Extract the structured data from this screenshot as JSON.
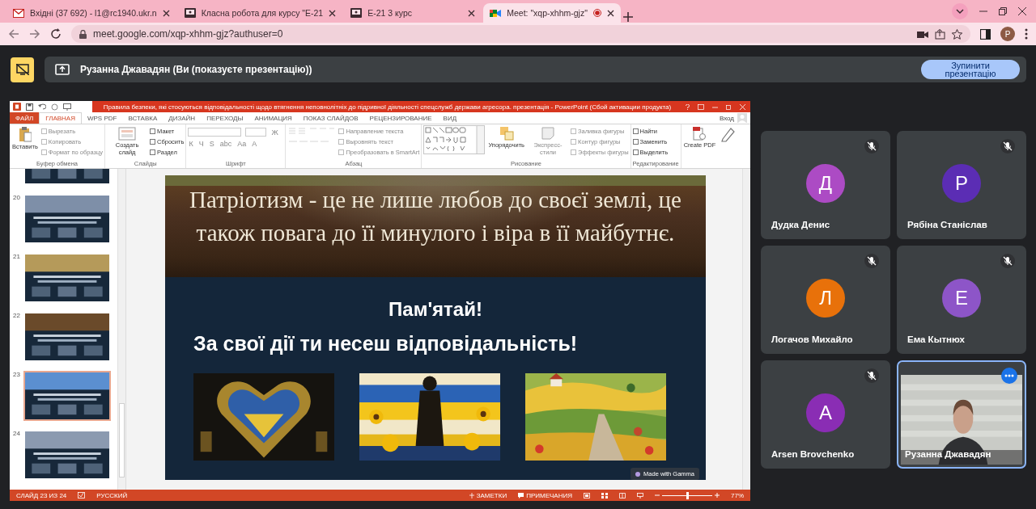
{
  "browser": {
    "tabs": [
      {
        "title": "Вхідні (37 692) - l1@rc1940.ukr.n",
        "kind": "mail",
        "selected": false,
        "recording": false
      },
      {
        "title": "Класна робота для курсу \"Е-21",
        "kind": "classroom",
        "selected": false,
        "recording": false
      },
      {
        "title": "Е-21 3 курс",
        "kind": "classroom",
        "selected": false,
        "recording": false
      },
      {
        "title": "Meet: \"xqp-xhhm-gjz\"",
        "kind": "meet",
        "selected": true,
        "recording": true
      }
    ],
    "url": "meet.google.com/xqp-xhhm-gjz?authuser=0",
    "profile": "P"
  },
  "meet": {
    "presenter_banner": "Рузанна Джавадян (Ви (показуєте презентацію))",
    "stop_button": "Зупинити презентацію"
  },
  "powerpoint": {
    "title": "Правила безпеки, які стосуються відповідальності щодо втягнення неповнолітніх до підривної діяльності спецслужб держави агресора. презентація - PowerPoint (Сбой активации продукта)",
    "ribbon_tabs": [
      {
        "label": "ФАЙЛ",
        "kind": "file",
        "selected": false
      },
      {
        "label": "ГЛАВНАЯ",
        "kind": "tab",
        "selected": true
      },
      {
        "label": "WPS PDF",
        "kind": "tab",
        "selected": false
      },
      {
        "label": "ВСТАВКА",
        "kind": "tab",
        "selected": false
      },
      {
        "label": "ДИЗАЙН",
        "kind": "tab",
        "selected": false
      },
      {
        "label": "ПЕРЕХОДЫ",
        "kind": "tab",
        "selected": false
      },
      {
        "label": "АНИМАЦИЯ",
        "kind": "tab",
        "selected": false
      },
      {
        "label": "ПОКАЗ СЛАЙДОВ",
        "kind": "tab",
        "selected": false
      },
      {
        "label": "РЕЦЕНЗИРОВАНИЕ",
        "kind": "tab",
        "selected": false
      },
      {
        "label": "ВИД",
        "kind": "tab",
        "selected": false
      }
    ],
    "sign_in": "Вход",
    "groups": [
      {
        "label": "Буфер обмена",
        "items": [
          {
            "kind": "large",
            "label": "Вставить",
            "disabled": false
          },
          {
            "kind": "small",
            "label": "Вырезать",
            "disabled": true
          },
          {
            "kind": "small",
            "label": "Копировать",
            "disabled": true
          },
          {
            "kind": "small",
            "label": "Формат по образцу",
            "disabled": true
          }
        ]
      },
      {
        "label": "Слайды",
        "items": [
          {
            "kind": "large",
            "label": "Создать слайд",
            "disabled": false
          },
          {
            "kind": "small",
            "label": "Макет",
            "disabled": false
          },
          {
            "kind": "small",
            "label": "Сбросить",
            "disabled": false
          },
          {
            "kind": "small",
            "label": "Раздел",
            "disabled": false
          }
        ]
      },
      {
        "label": "Шрифт",
        "items": [
          {
            "kind": "field"
          },
          {
            "kind": "field"
          },
          {
            "kind": "format",
            "label": "Ж",
            "disabled": true
          },
          {
            "kind": "format",
            "label": "К",
            "disabled": true
          },
          {
            "kind": "format",
            "label": "Ч",
            "disabled": true
          },
          {
            "kind": "format",
            "label": "S",
            "disabled": true
          },
          {
            "kind": "format",
            "label": "abc",
            "disabled": true
          },
          {
            "kind": "format",
            "label": "Aa",
            "disabled": true
          },
          {
            "kind": "format",
            "label": "A",
            "disabled": true
          }
        ]
      },
      {
        "label": "Абзац",
        "items": [
          {
            "kind": "lists",
            "disabled": true
          },
          {
            "kind": "small",
            "label": "Направление текста",
            "disabled": true
          },
          {
            "kind": "small",
            "label": "Выровнять текст",
            "disabled": true
          },
          {
            "kind": "small",
            "label": "Преобразовать в SmartArt",
            "disabled": true
          }
        ]
      },
      {
        "label": "Рисование",
        "items": [
          {
            "kind": "shapes",
            "disabled": false
          },
          {
            "kind": "large",
            "label": "Упорядочить",
            "disabled": false
          },
          {
            "kind": "large",
            "label": "Экспресс-стили",
            "disabled": true
          },
          {
            "kind": "small",
            "label": "Заливка фигуры",
            "disabled": true
          },
          {
            "kind": "small",
            "label": "Контур фигуры",
            "disabled": true
          },
          {
            "kind": "small",
            "label": "Эффекты фигуры",
            "disabled": true
          }
        ]
      },
      {
        "label": "Редактирование",
        "items": [
          {
            "kind": "small",
            "label": "Найти",
            "disabled": false
          },
          {
            "kind": "small",
            "label": "Заменить",
            "disabled": false
          },
          {
            "kind": "small",
            "label": "Выделить",
            "disabled": false
          }
        ]
      },
      {
        "items": [
          {
            "kind": "large",
            "label": "Create PDF",
            "disabled": false
          },
          {
            "kind": "large"
          }
        ]
      }
    ],
    "thumbnails": [
      {
        "kind": "partial",
        "selected": false
      },
      {
        "number": "20",
        "kind": "picture",
        "selected": false
      },
      {
        "number": "21",
        "kind": "picture",
        "selected": false
      },
      {
        "number": "22",
        "kind": "picture",
        "selected": false
      },
      {
        "number": "23",
        "kind": "picture",
        "selected": true
      },
      {
        "number": "24",
        "kind": "picture",
        "selected": false
      }
    ],
    "slide": {
      "title_lines": [
        "Патріотизм - це не лише любов до своєї землі, це",
        "також повага до її минулого і віра в її майбутнє."
      ],
      "heading": "Пам'ятай!",
      "subheading": "За свої дії ти несеш відповідальність!",
      "cards": [
        {
          "kind": "heart"
        },
        {
          "kind": "sunflowers"
        },
        {
          "kind": "fields"
        }
      ],
      "badge": "Made with Gamma"
    },
    "status_bar": {
      "slide_counter": "СЛАЙД 23 ИЗ 24",
      "language": "РУССКИЙ",
      "notes": "ЗАМЕТКИ",
      "comments": "ПРИМЕЧАНИЯ",
      "zoom": {
        "level": 0.5,
        "reading": "77%"
      }
    }
  },
  "participants": [
    {
      "name": "Дудка Денис",
      "initial": "Д",
      "color": "#ac4bc4",
      "muted": true,
      "kind": "avatar",
      "highlighted": false
    },
    {
      "name": "Рябіна Станіслав",
      "initial": "Р",
      "color": "#5b2db4",
      "muted": true,
      "kind": "avatar",
      "highlighted": false
    },
    {
      "name": "Логачов Михайло",
      "initial": "Л",
      "color": "#e8710a",
      "muted": true,
      "kind": "avatar",
      "highlighted": false
    },
    {
      "name": "Ема Кытнюх",
      "initial": "Е",
      "color": "#8d55c8",
      "muted": true,
      "kind": "avatar",
      "highlighted": false
    },
    {
      "name": "Arsen Brovchenko",
      "initial": "A",
      "color": "#8a2db4",
      "muted": true,
      "kind": "avatar",
      "highlighted": false
    },
    {
      "name": "Рузанна Джавадян",
      "kind": "video",
      "muted": false,
      "highlighted": true
    }
  ]
}
